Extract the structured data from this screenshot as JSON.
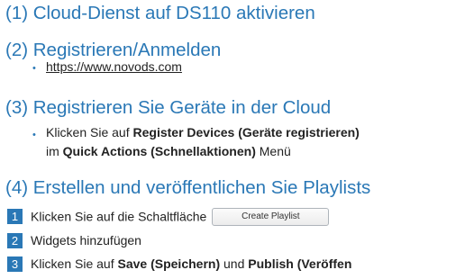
{
  "sections": [
    {
      "title": "(1)  Cloud-Dienst auf DS110 aktivieren"
    },
    {
      "title": "(2)  Registrieren/Anmelden",
      "bullet": "•",
      "link": "https://www.novods.com"
    },
    {
      "title": "(3)  Registrieren Sie Geräte in der Cloud",
      "bullet": "•",
      "line1_pre": "Klicken Sie auf ",
      "line1_bold": "Register Devices (Geräte registrieren)",
      "line2_pre": "im ",
      "line2_bold": "Quick Actions (Schnellaktionen)",
      "line2_post": " Menü"
    },
    {
      "title": "(4)  Erstellen und veröffentlichen Sie Playlists",
      "steps": [
        {
          "num": "1",
          "text": "Klicken Sie auf die Schaltfläche",
          "button": "Create Playlist"
        },
        {
          "num": "2",
          "text": "Widgets hinzufügen"
        },
        {
          "num": "3",
          "pre": "Klicken Sie auf ",
          "bold1": "Save (Speichern)",
          "mid": " und ",
          "bold2": "Publish (Veröffen"
        }
      ]
    }
  ],
  "colors": {
    "accent": "#2a78b6",
    "text": "#222222"
  }
}
